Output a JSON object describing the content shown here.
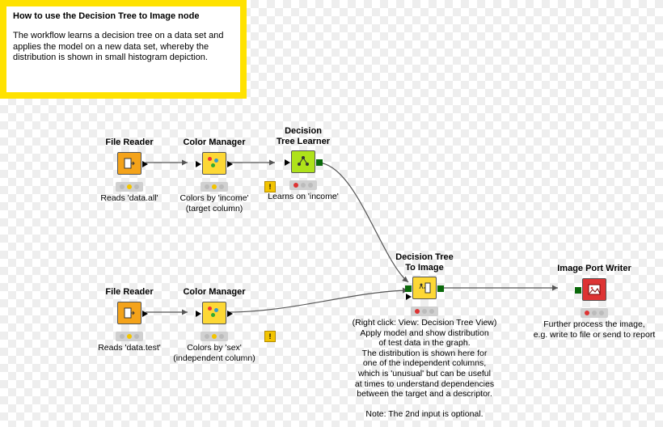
{
  "sticky": {
    "title": "How to use the Decision Tree to Image node",
    "body": "The workflow learns a decision tree on a data set and applies the model on a new data set, whereby the distribution is shown in small histogram depiction."
  },
  "nodes": {
    "file1": {
      "title": "File Reader",
      "desc": "Reads 'data.all'"
    },
    "color1": {
      "title": "Color Manager",
      "desc": "Colors by 'income'\n(target column)"
    },
    "learn": {
      "title": "Decision\nTree Learner",
      "desc": "Learns on 'income'"
    },
    "file2": {
      "title": "File Reader",
      "desc": "Reads 'data.test'"
    },
    "color2": {
      "title": "Color Manager",
      "desc": "Colors by 'sex'\n(independent column)"
    },
    "toimg": {
      "title": "Decision Tree\nTo Image",
      "desc": "(Right click: View: Decision Tree View)\nApply model and show distribution\nof test data in the graph.\nThe distribution is shown here for\none of the independent columns,\nwhich is 'unusual' but can be useful\nat times to understand dependencies\nbetween the target and a descriptor.\n\nNote: The 2nd input is optional."
    },
    "writer": {
      "title": "Image Port Writer",
      "desc": "Further process the image,\ne.g. write to file or send to report"
    }
  }
}
